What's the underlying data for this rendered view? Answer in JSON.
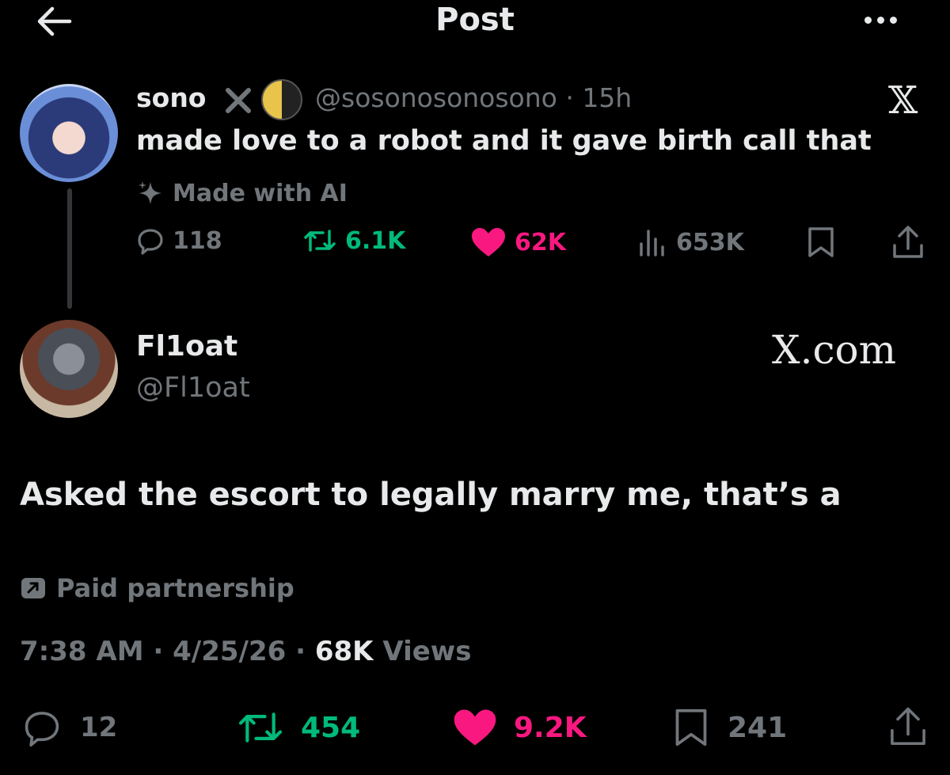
{
  "header": {
    "title": "Post"
  },
  "quoted": {
    "name": "sono",
    "handle": "@sosonosonosono · 15h",
    "text": "made love to a robot and it gave birth call that",
    "label": "Made with AI",
    "stats": {
      "replies": "118",
      "reposts": "6.1K",
      "likes": "62K",
      "views": "653K"
    }
  },
  "post": {
    "name": "Fl1oat",
    "handle": "@Fl1oat",
    "watermark": "X.com",
    "text": "Asked the escort to legally marry me, that’s a",
    "paid_label": "Paid partnership",
    "meta_time": "7:38 AM · 4/25/26 · ",
    "meta_views_count": "68K",
    "meta_views_label": " Views",
    "stats": {
      "replies": "12",
      "reposts": "454",
      "likes": "9.2K",
      "bookmarks": "241"
    }
  },
  "colors": {
    "bg": "#000000",
    "text": "#e7e9ea",
    "muted": "#71767b",
    "repost": "#00ba7c",
    "like": "#f91880"
  },
  "icons": [
    "back-arrow-icon",
    "more-icon",
    "x-logo-icon",
    "sparkle-icon",
    "reply-icon",
    "repost-icon",
    "heart-icon",
    "views-icon",
    "bookmark-icon",
    "share-icon",
    "paid-icon"
  ]
}
